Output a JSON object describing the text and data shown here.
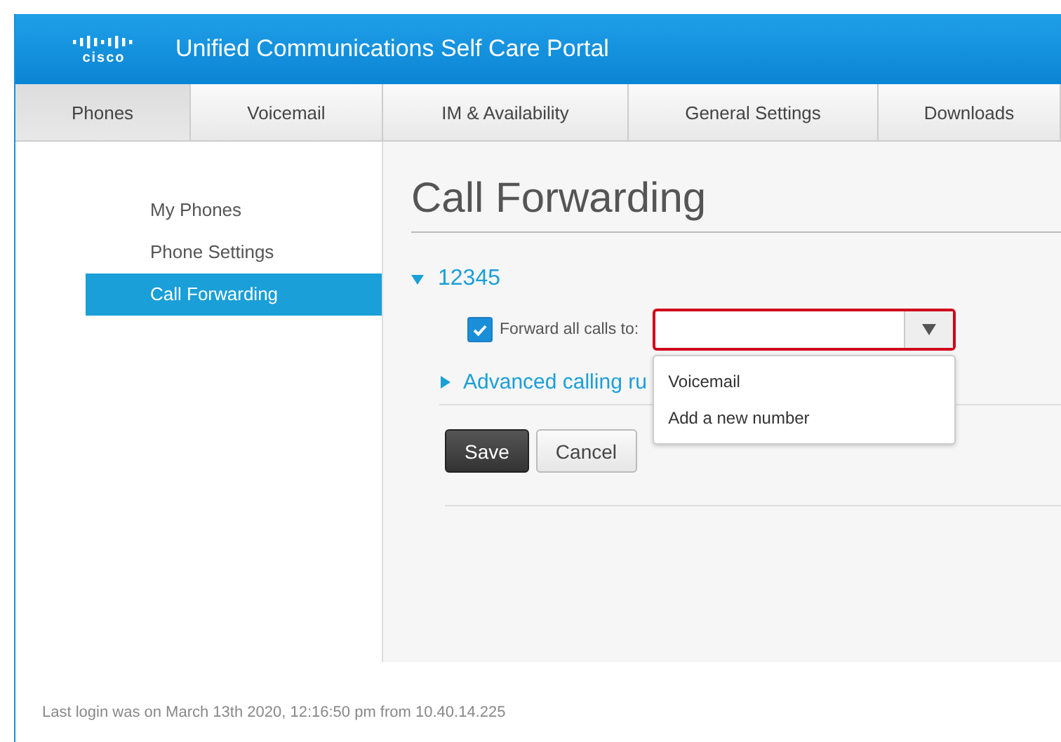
{
  "header": {
    "logo": "cisco",
    "title": "Unified Communications Self Care Portal"
  },
  "tabs": [
    {
      "label": "Phones",
      "selected": true
    },
    {
      "label": "Voicemail",
      "selected": false
    },
    {
      "label": "IM & Availability",
      "selected": false
    },
    {
      "label": "General Settings",
      "selected": false
    },
    {
      "label": "Downloads",
      "selected": false
    }
  ],
  "sidebar": {
    "items": [
      {
        "label": "My Phones",
        "selected": false
      },
      {
        "label": "Phone Settings",
        "selected": false
      },
      {
        "label": "Call Forwarding",
        "selected": true
      }
    ]
  },
  "content": {
    "heading": "Call Forwarding",
    "line": {
      "number": "12345",
      "expanded": true,
      "forward_all": {
        "label": "Forward all calls to:",
        "checked": true,
        "focused": true,
        "dropdown": {
          "open": true,
          "options": [
            "Voicemail",
            "Add a new number"
          ]
        }
      }
    },
    "advanced": {
      "label": "Advanced calling ru",
      "expanded": false
    },
    "buttons": [
      {
        "label": "Save",
        "kind": "primary"
      },
      {
        "label": "Cancel",
        "kind": "secondary"
      }
    ]
  },
  "footer": {
    "last_login": "Last login was on March 13th 2020, 12:16:50 pm from 10.40.14.225"
  }
}
